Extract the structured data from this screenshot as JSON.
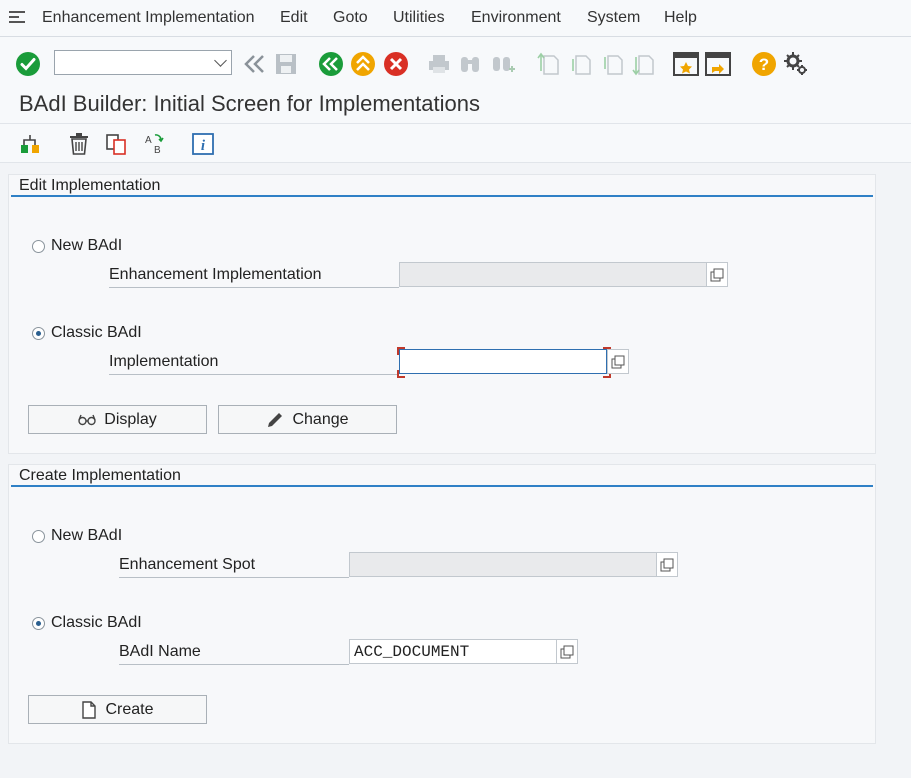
{
  "menu": {
    "items": [
      {
        "label": "Enhancement Implementation"
      },
      {
        "label": "Edit"
      },
      {
        "label": "Goto"
      },
      {
        "label": "Utilities"
      },
      {
        "label": "Environment"
      },
      {
        "label": "System"
      },
      {
        "label": "Help"
      }
    ]
  },
  "toolbar": {
    "command_field_value": "",
    "icons": [
      "enter-icon",
      "back-double-icon",
      "save-icon",
      "back-icon",
      "exit-icon",
      "cancel-icon",
      "print-icon",
      "find-icon",
      "find-next-icon",
      "first-page-icon",
      "previous-page-icon",
      "next-page-icon",
      "last-page-icon",
      "new-session-icon",
      "shortcut-icon",
      "help-icon",
      "customize-layout-icon"
    ],
    "colors": {
      "green": "#1a9c3a",
      "yellow": "#f0a500",
      "red": "#d93025"
    }
  },
  "title": "BAdI Builder: Initial Screen for Implementations",
  "app_toolbar": {
    "icons": [
      "hierarchy-icon",
      "delete-icon",
      "copy-icon",
      "rename-icon",
      "info-icon"
    ]
  },
  "edit_section": {
    "header": "Edit Implementation",
    "new_badi_label": "New BAdI",
    "enh_impl_label": "Enhancement Implementation",
    "enh_impl_value": "",
    "classic_badi_label": "Classic BAdI",
    "implementation_label": "Implementation",
    "implementation_value": "",
    "display_button": "Display",
    "change_button": "Change"
  },
  "create_section": {
    "header": "Create Implementation",
    "new_badi_label": "New BAdI",
    "enh_spot_label": "Enhancement Spot",
    "enh_spot_value": "",
    "classic_badi_label": "Classic BAdI",
    "badi_name_label": "BAdI Name",
    "badi_name_value": "ACC_DOCUMENT",
    "create_button": "Create"
  }
}
